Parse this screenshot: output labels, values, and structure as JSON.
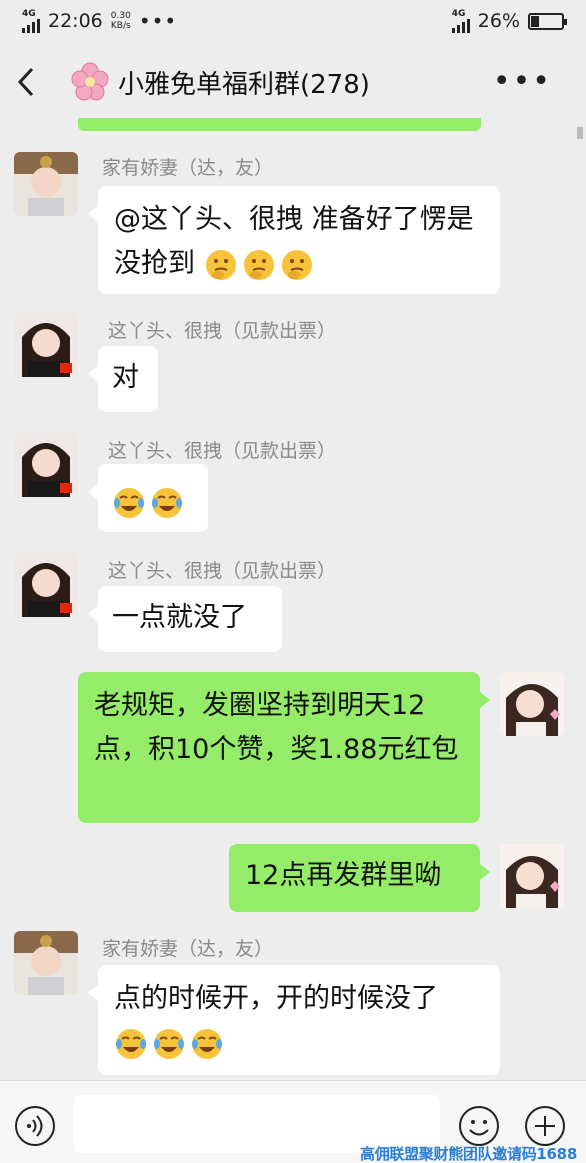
{
  "status_bar": {
    "network_left": "4G",
    "time": "22:06",
    "speed_value": "0.30",
    "speed_unit": "KB/s",
    "dots": "•••",
    "network_right": "4G",
    "battery": "26%"
  },
  "nav": {
    "title": "小雅免单福利群(278)",
    "more": "•••"
  },
  "messages": [
    {
      "sender": "家有娇妻（达，友）",
      "text": "@这丫头、很拽  准备好了愣是没抢到",
      "emojis": [
        "thinking-emoji",
        "thinking-emoji",
        "thinking-emoji"
      ]
    },
    {
      "sender": "这丫头、很拽（见款出票）",
      "text": "对",
      "emojis": []
    },
    {
      "sender": "这丫头、很拽（见款出票）",
      "text": "",
      "emojis": [
        "laugh-cry-emoji",
        "laugh-cry-emoji"
      ]
    },
    {
      "sender": "这丫头、很拽（见款出票）",
      "text": "一点就没了",
      "emojis": []
    },
    {
      "sender": "",
      "text": "老规矩，发圈坚持到明天12点，积10个赞，奖1.88元红包",
      "emojis": []
    },
    {
      "sender": "",
      "text": "12点再发群里呦",
      "emojis": []
    },
    {
      "sender": "家有娇妻（达，友）",
      "text": "点的时候开，开的时候没了",
      "emojis": [
        "laugh-cry-emoji",
        "laugh-cry-emoji",
        "laugh-cry-emoji"
      ]
    }
  ],
  "input_bar": {
    "placeholder": ""
  },
  "watermark": "高佣联盟聚财熊团队邀请码1688",
  "colors": {
    "background": "#ededed",
    "self_bubble": "#95ec69",
    "other_bubble": "#ffffff",
    "sender_name": "#8a8a8a",
    "watermark": "#2a7fd4"
  }
}
